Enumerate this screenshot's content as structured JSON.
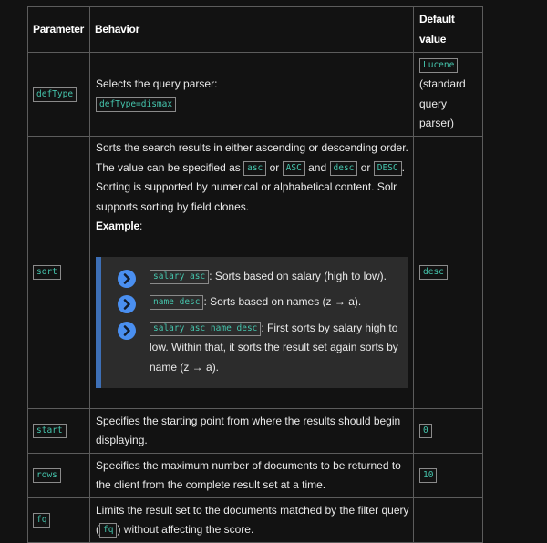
{
  "headers": {
    "parameter": "Parameter",
    "behavior": "Behavior",
    "default_value": "Default value"
  },
  "rows": [
    {
      "param": "defType",
      "behavior_text": "Selects the query parser:",
      "behavior_code": "defType=dismax",
      "default_code": "Lucene",
      "default_text": "(standard query parser)"
    },
    {
      "param": "sort",
      "behavior_1": "Sorts the search results in either ascending or descending order. The value can be specified as ",
      "code_asc": "asc",
      "or_1": " or ",
      "code_ASC": "ASC",
      "and_1": " and ",
      "code_desc": "desc",
      "or_2": " or ",
      "code_DESC": "DESC",
      "behavior_2": ". Sorting is supported by numerical or alphabetical content. Solr supports sorting by field clones.",
      "example_label": "Example",
      "example_colon": ":",
      "examples": [
        {
          "code": "salary asc",
          "text": ": Sorts based on salary (high to low)."
        },
        {
          "code": "name desc",
          "text": ": Sorts based on names (z → a)."
        },
        {
          "code": "salary asc name desc",
          "text": ": First sorts by salary high to low. Within that, it sorts the result set again sorts by name (z → a)."
        }
      ],
      "default_code": "desc"
    },
    {
      "param": "start",
      "behavior": "Specifies the starting point from where the results should begin displaying.",
      "default_code": "0"
    },
    {
      "param": "rows",
      "behavior": "Specifies the maximum number of documents to be returned to the client from the complete result set at a time.",
      "default_code": "10"
    },
    {
      "param": "fq",
      "behavior_1": "Limits the result set to the documents matched by the filter query (",
      "behavior_code": "fq",
      "behavior_2": ") without affecting the score.",
      "default_code": ""
    }
  ],
  "colors": {
    "background": "#121212",
    "border": "#5c5c5c",
    "code_text": "#45c4ac",
    "example_box": "#2c2c2c",
    "example_accent": "#3d6fb6",
    "bullet_icon": "#4a8ff0"
  },
  "icons": {
    "example_bullet": "chevron-right-circle-icon"
  }
}
